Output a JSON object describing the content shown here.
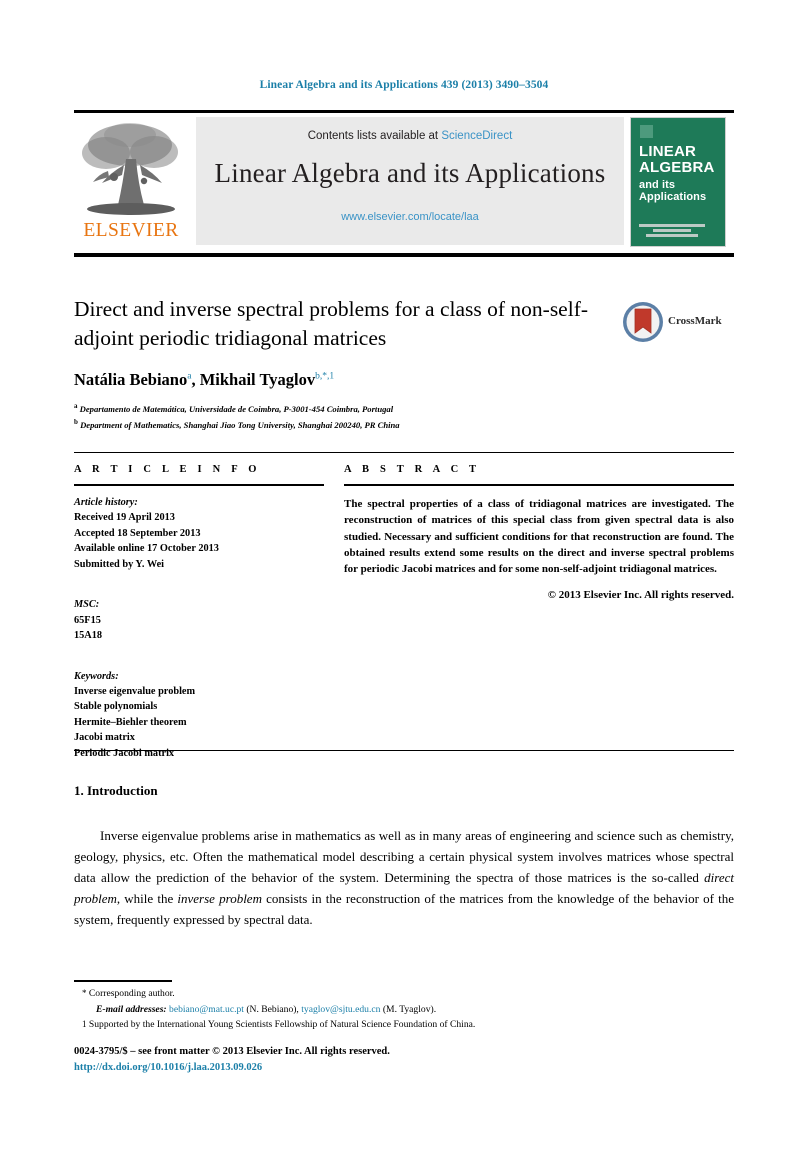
{
  "running_head": "Linear Algebra and its Applications 439 (2013) 3490–3504",
  "masthead": {
    "contents_prefix": "Contents lists available at ",
    "sciencedirect": "ScienceDirect",
    "journal_title": "Linear Algebra and its Applications",
    "journal_url": "www.elsevier.com/locate/laa",
    "publisher_wordmark": "ELSEVIER",
    "cover": {
      "line1": "LINEAR",
      "line2": "ALGEBRA",
      "line3": "and its",
      "line4": "Applications"
    },
    "colors": {
      "link_blue": "#3a93c6",
      "elsevier_orange": "#e87511",
      "cover_green": "#1e7a58",
      "band_gray": "#eaeaea"
    }
  },
  "article": {
    "title": "Direct and inverse spectral problems for a class of non-self-adjoint periodic tridiagonal matrices",
    "authors": [
      {
        "name": "Natália Bebiano",
        "marks": "a"
      },
      {
        "name": "Mikhail Tyaglov",
        "marks": "b,*,1"
      }
    ],
    "authors_separator": ", ",
    "affiliations": [
      {
        "mark": "a",
        "text": "Departamento de Matemática, Universidade de Coimbra, P-3001-454 Coimbra, Portugal"
      },
      {
        "mark": "b",
        "text": "Department of Mathematics, Shanghai Jiao Tong University, Shanghai 200240, PR China"
      }
    ],
    "crossmark_label": "CrossMark"
  },
  "info": {
    "heading": "A R T I C L E    I N F O",
    "history_title": "Article history:",
    "history": [
      "Received 19 April 2013",
      "Accepted 18 September 2013",
      "Available online 17 October 2013",
      "Submitted by Y. Wei"
    ],
    "msc_title": "MSC:",
    "msc": [
      "65F15",
      "15A18"
    ],
    "keywords_title": "Keywords:",
    "keywords": [
      "Inverse eigenvalue problem",
      "Stable polynomials",
      "Hermite–Biehler theorem",
      "Jacobi matrix",
      "Periodic Jacobi matrix"
    ]
  },
  "abstract": {
    "heading": "A B S T R A C T",
    "text": "The spectral properties of a class of tridiagonal matrices are investigated. The reconstruction of matrices of this special class from given spectral data is also studied. Necessary and sufficient conditions for that reconstruction are found. The obtained results extend some results on the direct and inverse spectral problems for periodic Jacobi matrices and for some non-self-adjoint tridiagonal matrices.",
    "copyright": "© 2013 Elsevier Inc. All rights reserved."
  },
  "body": {
    "section_number_title": "1. Introduction",
    "paragraph_1_part1": "Inverse eigenvalue problems arise in mathematics as well as in many areas of engineering and science such as chemistry, geology, physics, etc. Often the mathematical model describing a certain physical system involves matrices whose spectral data allow the prediction of the behavior of the system. Determining the spectra of those matrices is the so-called ",
    "paragraph_1_italic1": "direct problem",
    "paragraph_1_part2": ", while the ",
    "paragraph_1_italic2": "inverse problem",
    "paragraph_1_part3": " consists in the reconstruction of the matrices from the knowledge of the behavior of the system, frequently expressed by spectral data."
  },
  "footnotes": {
    "corresponding_mark": "*",
    "corresponding": "Corresponding author.",
    "email_label": "E-mail addresses:",
    "email_1": "bebiano@mat.uc.pt",
    "email_1_owner": "(N. Bebiano),",
    "email_2": "tyaglov@sjtu.edu.cn",
    "email_2_owner": "(M. Tyaglov).",
    "note_1_mark": "1",
    "note_1": "Supported by the International Young Scientists Fellowship of Natural Science Foundation of China."
  },
  "imprint": {
    "issn_line": "0024-3795/$ – see front matter © 2013 Elsevier Inc. All rights reserved.",
    "doi": "http://dx.doi.org/10.1016/j.laa.2013.09.026"
  }
}
